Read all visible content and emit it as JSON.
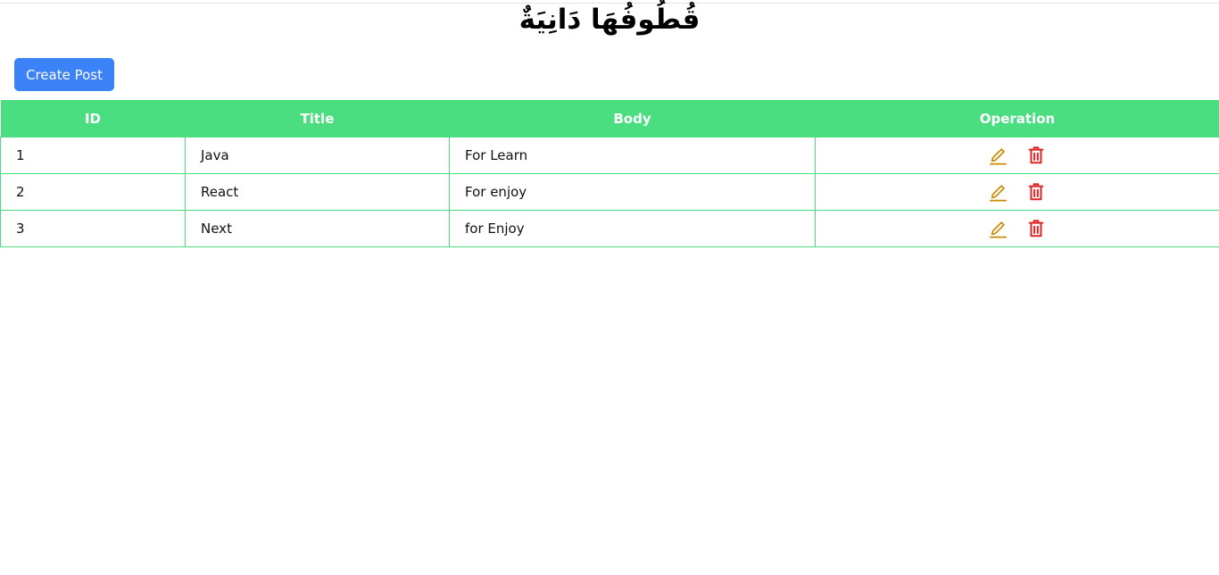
{
  "header": {
    "title": "قُطُوفُهَا دَانِيَةٌ"
  },
  "toolbar": {
    "create_label": "Create Post"
  },
  "table": {
    "columns": [
      "ID",
      "Title",
      "Body",
      "Operation"
    ],
    "rows": [
      {
        "id": "1",
        "title": "Java",
        "body": "For Learn"
      },
      {
        "id": "2",
        "title": "React",
        "body": "For enjoy"
      },
      {
        "id": "3",
        "title": "Next",
        "body": "for Enjoy"
      }
    ]
  },
  "icons": {
    "edit": "pencil-icon",
    "delete": "trash-icon"
  },
  "colors": {
    "accent": "#3b82f6",
    "header_bg": "#4ade80",
    "edit": "#ca8a04",
    "delete": "#dc2626"
  }
}
